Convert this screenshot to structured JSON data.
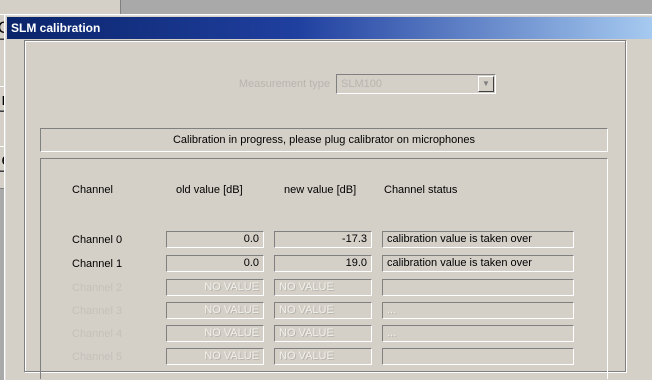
{
  "background_window": {
    "buttons": [
      "O",
      "n",
      "e"
    ]
  },
  "dialog": {
    "title": "SLM calibration",
    "selector": {
      "label": "Measurement type",
      "value": "SLM100",
      "arrow": "▼"
    },
    "status_message": "Calibration in progress, please plug calibrator on microphones",
    "table": {
      "headers": [
        "Channel",
        "old value [dB]",
        "new value [dB]",
        "Channel status"
      ],
      "rows": [
        {
          "channel": "Channel  0",
          "old": "0.0",
          "new": "-17.3",
          "status": "calibration value is taken over",
          "enabled": true
        },
        {
          "channel": "Channel  1",
          "old": "0.0",
          "new": "19.0",
          "status": "calibration value is taken over",
          "enabled": true
        },
        {
          "channel": "Channel  2",
          "old": "NO VALUE",
          "new": "NO VALUE",
          "status": "",
          "enabled": false
        },
        {
          "channel": "Channel  3",
          "old": "NO VALUE",
          "new": "NO VALUE",
          "status": "...",
          "enabled": false
        },
        {
          "channel": "Channel  4",
          "old": "NO VALUE",
          "new": "NO VALUE",
          "status": "...",
          "enabled": false
        },
        {
          "channel": "Channel  5",
          "old": "NO VALUE",
          "new": "NO VALUE",
          "status": "",
          "enabled": false
        }
      ]
    }
  },
  "colors": {
    "title_bar_start": "#0a246a",
    "title_bar_end": "#a6caf0",
    "face": "#d4d0c8"
  }
}
